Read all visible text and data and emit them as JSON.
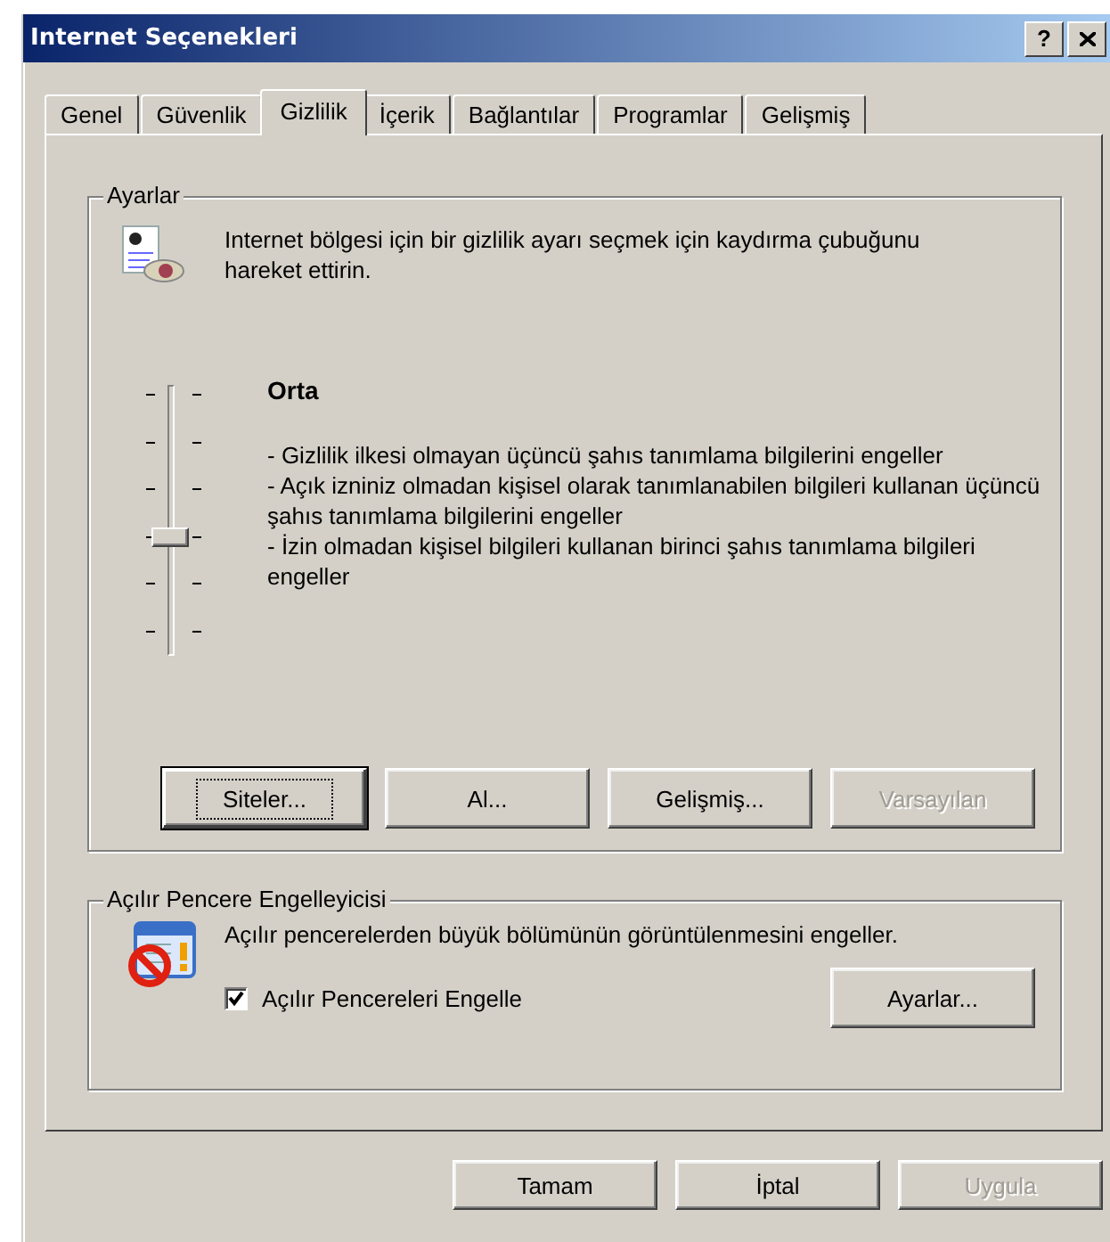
{
  "window": {
    "title": "Internet Seçenekleri",
    "help_button": "?"
  },
  "tabs": [
    {
      "label": "Genel",
      "selected": false
    },
    {
      "label": "Güvenlik",
      "selected": false
    },
    {
      "label": "Gizlilik",
      "selected": true
    },
    {
      "label": "İçerik",
      "selected": false
    },
    {
      "label": "Bağlantılar",
      "selected": false
    },
    {
      "label": "Programlar",
      "selected": false
    },
    {
      "label": "Gelişmiş",
      "selected": false
    }
  ],
  "settings": {
    "title": "Ayarlar",
    "intro": "Internet bölgesi için bir gizlilik ayarı seçmek için kaydırma çubuğunu hareket ettirin.",
    "slider": {
      "level": 0.4
    },
    "level_name": "Orta",
    "description": [
      "- Gizlilik ilkesi olmayan üçüncü şahıs tanımlama bilgilerini engeller",
      "- Açık izniniz olmadan kişisel olarak tanımlanabilen bilgileri kullanan üçüncü şahıs tanımlama bilgilerini engeller",
      "- İzin olmadan kişisel bilgileri kullanan birinci şahıs tanımlama bilgileri engeller"
    ],
    "buttons": [
      {
        "label": "Siteler...",
        "focused": true,
        "disabled": false
      },
      {
        "label": "Al...",
        "focused": false,
        "disabled": false
      },
      {
        "label": "Gelişmiş...",
        "focused": false,
        "disabled": false
      },
      {
        "label": "Varsayılan",
        "focused": false,
        "disabled": true
      }
    ]
  },
  "popup_blocker": {
    "title": "Açılır Pencere Engelleyicisi",
    "text": "Açılır pencerelerden büyük bölümünün görüntülenmesini engeller.",
    "checkbox": {
      "label": "Açılır Pencereleri Engelle",
      "checked": true
    },
    "button": {
      "label": "Ayarlar...",
      "disabled": false
    }
  },
  "footer_buttons": [
    {
      "label": "Tamam",
      "disabled": false
    },
    {
      "label": "İptal",
      "disabled": false
    },
    {
      "label": "Uygula",
      "disabled": true
    }
  ]
}
